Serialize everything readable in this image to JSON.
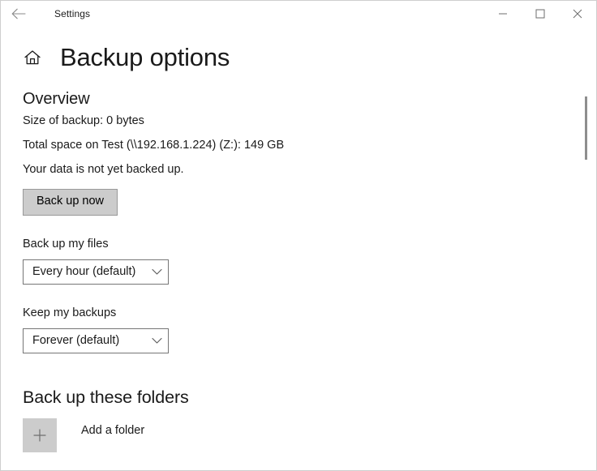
{
  "titlebar": {
    "back_icon": "back-arrow-icon",
    "app_title": "Settings",
    "minimize_label": "minimize-icon",
    "maximize_label": "maximize-icon",
    "close_label": "close-icon"
  },
  "header": {
    "home_icon": "home-icon",
    "page_title": "Backup options"
  },
  "overview": {
    "heading": "Overview",
    "size_of_backup": "Size of backup: 0 bytes",
    "total_space": "Total space on Test (\\\\192.168.1.224) (Z:): 149 GB",
    "status": "Your data is not yet backed up.",
    "backup_now_button": "Back up now"
  },
  "backup_frequency": {
    "label": "Back up my files",
    "selected": "Every hour (default)",
    "chevron_icon": "chevron-down-icon"
  },
  "keep_backups": {
    "label": "Keep my backups",
    "selected": "Forever (default)",
    "chevron_icon": "chevron-down-icon"
  },
  "folders": {
    "heading": "Back up these folders",
    "add_folder_icon": "plus-icon",
    "add_folder_label": "Add a folder"
  },
  "colors": {
    "window_background": "#ffffff",
    "text_primary": "#1a1a1a",
    "button_fill": "#cccccc",
    "button_border": "#999999",
    "combo_border": "#767676",
    "scrollbar_thumb": "#8e8e8e",
    "window_border": "#cfcfcf"
  }
}
